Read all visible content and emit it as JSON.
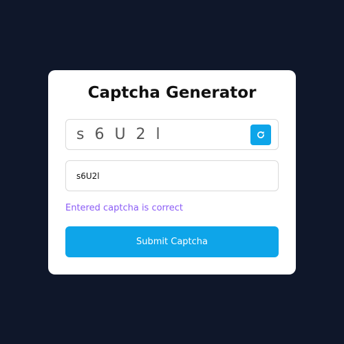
{
  "title": "Captcha Generator",
  "captcha": {
    "text": "s6U2l",
    "refresh_icon": "refresh-icon"
  },
  "input": {
    "value": "s6U2l",
    "placeholder": ""
  },
  "status": {
    "message": "Entered captcha is correct"
  },
  "submit": {
    "label": "Submit Captcha"
  },
  "colors": {
    "background": "#0f172a",
    "accent": "#0ea5e9",
    "status": "#8b5cf6"
  }
}
